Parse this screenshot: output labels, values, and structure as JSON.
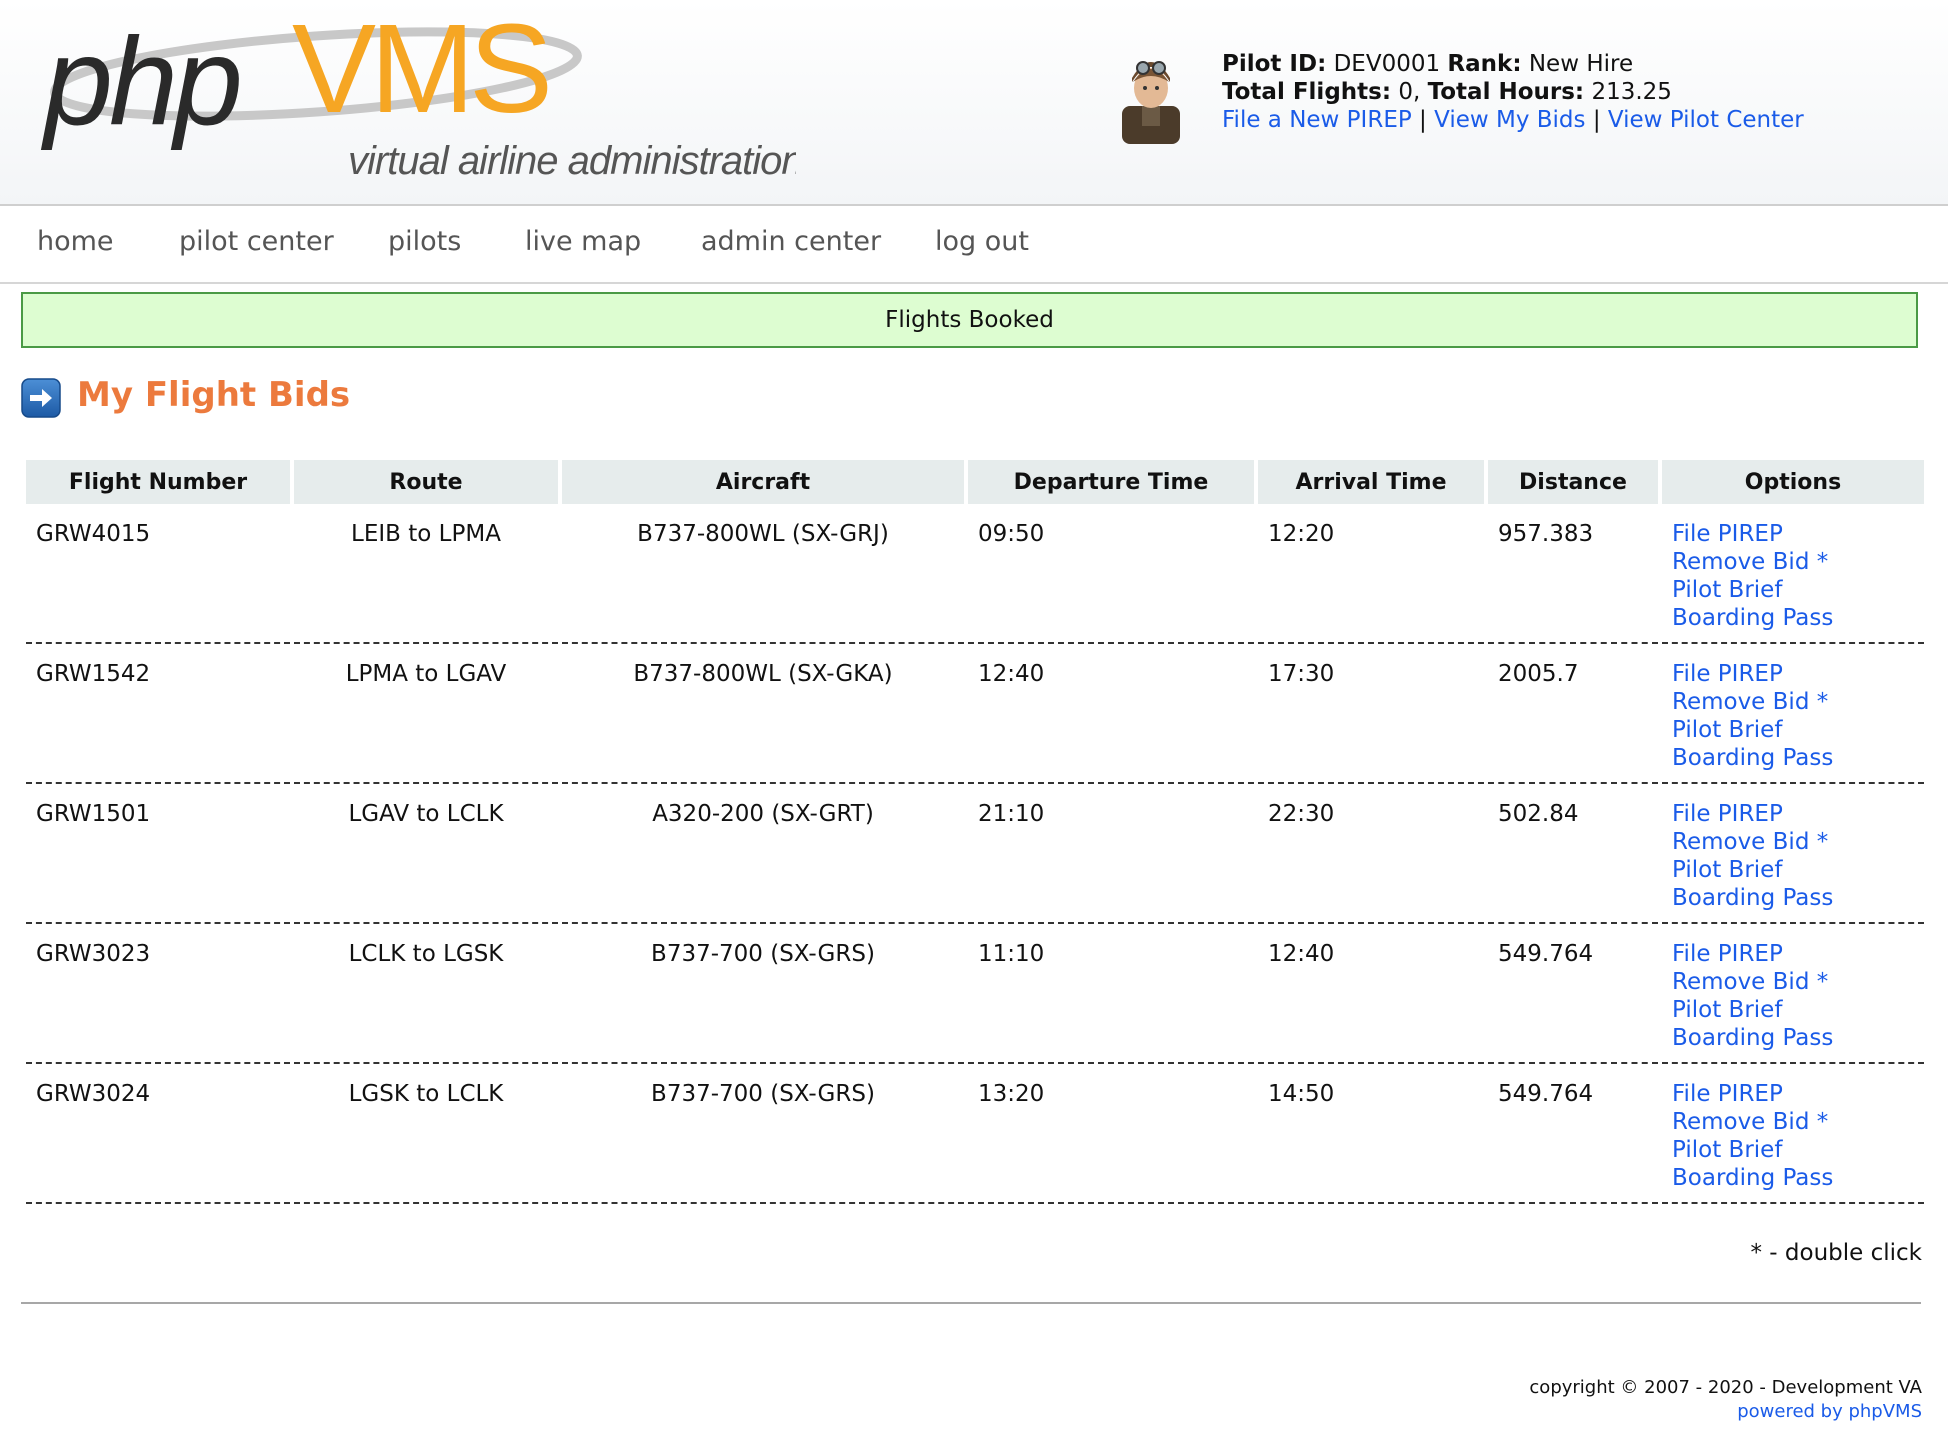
{
  "header": {
    "logo_text_php": "php",
    "logo_text_vms": "VMS",
    "logo_tagline": "virtual airline administration",
    "pilot_id_label": "Pilot ID:",
    "pilot_id": "DEV0001",
    "rank_label": "Rank:",
    "rank": "New Hire",
    "total_flights_label": "Total Flights:",
    "total_flights": "0,",
    "total_hours_label": "Total Hours:",
    "total_hours": "213.25",
    "links": {
      "file_pirep": "File a New PIREP",
      "view_bids": "View My Bids",
      "view_pilot_center": "View Pilot Center",
      "separator": "|"
    }
  },
  "nav": {
    "items": [
      "home",
      "pilot center",
      "pilots",
      "live map",
      "admin center",
      "log out"
    ]
  },
  "flash": "Flights Booked",
  "page_title": "My Flight Bids",
  "table": {
    "headers": [
      "Flight Number",
      "Route",
      "Aircraft",
      "Departure Time",
      "Arrival Time",
      "Distance",
      "Options"
    ],
    "options": [
      "File PIREP",
      "Remove Bid *",
      "Pilot Brief",
      "Boarding Pass"
    ],
    "rows": [
      {
        "flight": "GRW4015",
        "route": "LEIB to LPMA",
        "aircraft": "B737-800WL (SX-GRJ)",
        "dep": "09:50",
        "arr": "12:20",
        "distance": "957.383"
      },
      {
        "flight": "GRW1542",
        "route": "LPMA to LGAV",
        "aircraft": "B737-800WL (SX-GKA)",
        "dep": "12:40",
        "arr": "17:30",
        "distance": "2005.7"
      },
      {
        "flight": "GRW1501",
        "route": "LGAV to LCLK",
        "aircraft": "A320-200 (SX-GRT)",
        "dep": "21:10",
        "arr": "22:30",
        "distance": "502.84"
      },
      {
        "flight": "GRW3023",
        "route": "LCLK to LGSK",
        "aircraft": "B737-700 (SX-GRS)",
        "dep": "11:10",
        "arr": "12:40",
        "distance": "549.764"
      },
      {
        "flight": "GRW3024",
        "route": "LGSK to LCLK",
        "aircraft": "B737-700 (SX-GRS)",
        "dep": "13:20",
        "arr": "14:50",
        "distance": "549.764"
      }
    ]
  },
  "footnote": "* - double click",
  "footer": {
    "copyright": "copyright © 2007 - 2020 - Development VA",
    "powered_by": "powered by phpVMS"
  },
  "colors": {
    "link": "#1a5be8",
    "title": "#ec7a3d",
    "logo_orange": "#f6a623",
    "flash_bg": "#ddfdd1",
    "flash_border": "#4a9a45",
    "table_header_bg": "#e6ecec"
  },
  "icons": {
    "heading": "arrow-right-icon",
    "avatar": "pilot-avatar-icon"
  }
}
